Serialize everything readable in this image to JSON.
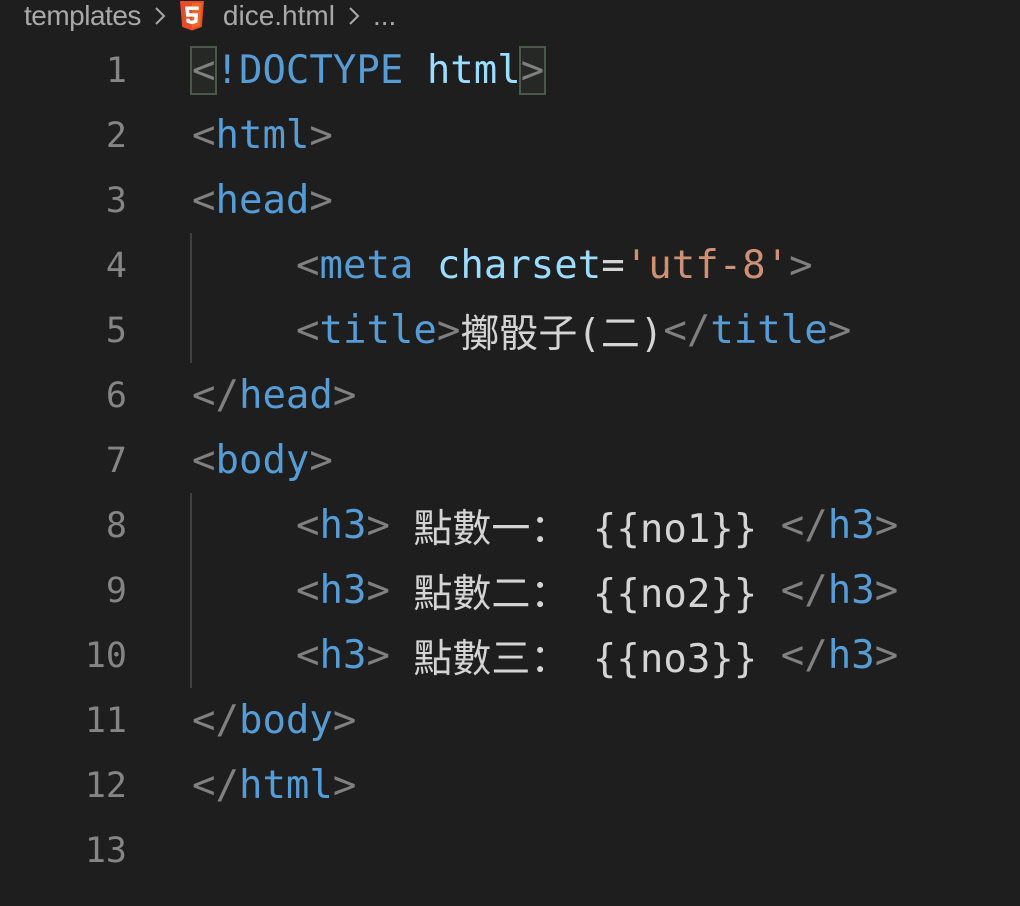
{
  "breadcrumb": {
    "folder": "templates",
    "file": "dice.html",
    "more": "..."
  },
  "icons": {
    "html5": "html5-icon",
    "separator": "chevron-right-icon"
  },
  "colors": {
    "background": "#1e1e1e",
    "line_number": "#858585",
    "punctuation": "#808080",
    "tag": "#569cd6",
    "attribute": "#9cdcfe",
    "string": "#ce9178",
    "text": "#d4d4d4",
    "html5_icon": "#e44d26"
  },
  "editor": {
    "line_numbers": [
      "1",
      "2",
      "3",
      "4",
      "5",
      "6",
      "7",
      "8",
      "9",
      "10",
      "11",
      "12",
      "13"
    ],
    "lines": {
      "l1": {
        "open": "<",
        "bang": "!DOCTYPE",
        "sp": " ",
        "name": "html",
        "close": ">"
      },
      "l2": {
        "open": "<",
        "tag": "html",
        "close": ">"
      },
      "l3": {
        "open": "<",
        "tag": "head",
        "close": ">"
      },
      "l4": {
        "open": "<",
        "tag": "meta",
        "sp": " ",
        "attr": "charset",
        "eq": "=",
        "val": "'utf-8'",
        "close": ">"
      },
      "l5": {
        "open": "<",
        "tag": "title",
        "close": ">",
        "text": "擲骰子(二)",
        "end_open": "</",
        "end_tag": "title",
        "end_close": ">"
      },
      "l6": {
        "open": "</",
        "tag": "head",
        "close": ">"
      },
      "l7": {
        "open": "<",
        "tag": "body",
        "close": ">"
      },
      "l8": {
        "open": "<",
        "tag": "h3",
        "close": ">",
        "text": " 點數一： {{no1}} ",
        "end_open": "</",
        "end_tag": "h3",
        "end_close": ">"
      },
      "l9": {
        "open": "<",
        "tag": "h3",
        "close": ">",
        "text": " 點數二： {{no2}} ",
        "end_open": "</",
        "end_tag": "h3",
        "end_close": ">"
      },
      "l10": {
        "open": "<",
        "tag": "h3",
        "close": ">",
        "text": " 點數三： {{no3}} ",
        "end_open": "</",
        "end_tag": "h3",
        "end_close": ">"
      },
      "l11": {
        "open": "</",
        "tag": "body",
        "close": ">"
      },
      "l12": {
        "open": "</",
        "tag": "html",
        "close": ">"
      }
    }
  }
}
